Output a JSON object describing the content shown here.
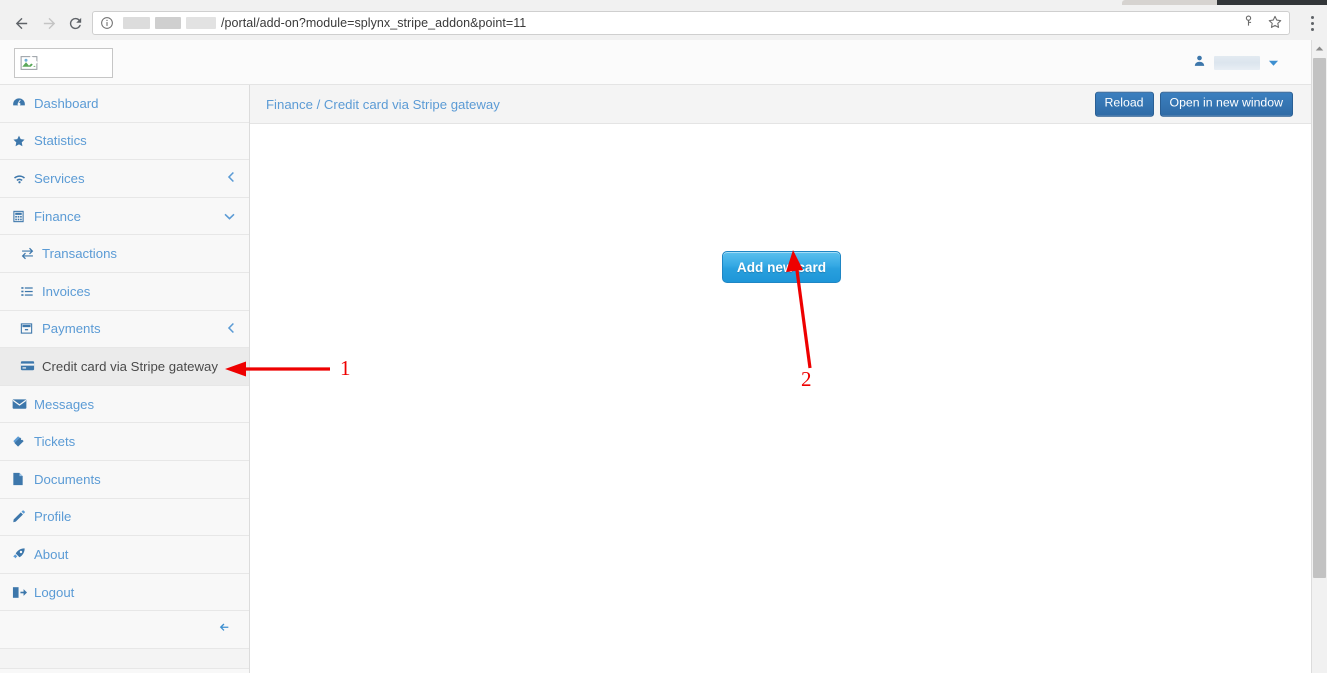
{
  "browser": {
    "url_text": "/portal/add-on?module=splynx_stripe_addon&point=11",
    "back_icon": "arrow-left-icon",
    "forward_icon": "arrow-right-icon",
    "reload_icon": "reload-icon",
    "info_icon": "page-info-icon",
    "key_icon": "password-key-icon",
    "star_icon": "bookmark-star-icon",
    "menu_icon": "three-dot-menu-icon"
  },
  "app_header": {
    "logo_icon": "broken-image-icon",
    "user_icon": "user-avatar-icon",
    "caret_icon": "caret-down-icon"
  },
  "sidebar": {
    "items": [
      {
        "label": "Dashboard",
        "icon": "dashboard-icon",
        "sub": false,
        "active": false,
        "chevron": ""
      },
      {
        "label": "Statistics",
        "icon": "star-icon",
        "sub": false,
        "active": false,
        "chevron": ""
      },
      {
        "label": "Services",
        "icon": "wifi-icon",
        "sub": false,
        "active": false,
        "chevron": "left"
      },
      {
        "label": "Finance",
        "icon": "calculator-icon",
        "sub": false,
        "active": false,
        "chevron": "down"
      },
      {
        "label": "Transactions",
        "icon": "exchange-icon",
        "sub": true,
        "active": false,
        "chevron": ""
      },
      {
        "label": "Invoices",
        "icon": "list-icon",
        "sub": true,
        "active": false,
        "chevron": ""
      },
      {
        "label": "Payments",
        "icon": "payment-box-icon",
        "sub": true,
        "active": false,
        "chevron": "left"
      },
      {
        "label": "Credit card via Stripe gateway",
        "icon": "credit-card-icon",
        "sub": true,
        "active": true,
        "chevron": ""
      },
      {
        "label": "Messages",
        "icon": "envelope-icon",
        "sub": false,
        "active": false,
        "chevron": ""
      },
      {
        "label": "Tickets",
        "icon": "ticket-icon",
        "sub": false,
        "active": false,
        "chevron": ""
      },
      {
        "label": "Documents",
        "icon": "document-icon",
        "sub": false,
        "active": false,
        "chevron": ""
      },
      {
        "label": "Profile",
        "icon": "pencil-icon",
        "sub": false,
        "active": false,
        "chevron": ""
      },
      {
        "label": "About",
        "icon": "rocket-icon",
        "sub": false,
        "active": false,
        "chevron": ""
      },
      {
        "label": "Logout",
        "icon": "sign-out-icon",
        "sub": false,
        "active": false,
        "chevron": ""
      }
    ],
    "collapse_icon": "arrow-left-icon"
  },
  "content": {
    "breadcrumb": "Finance / Credit card via Stripe gateway",
    "reload_label": "Reload",
    "open_new_window_label": "Open in new window",
    "add_new_card_label": "Add new card"
  },
  "annotations": {
    "marker_1": "1",
    "marker_2": "2",
    "color": "#ee0000"
  }
}
